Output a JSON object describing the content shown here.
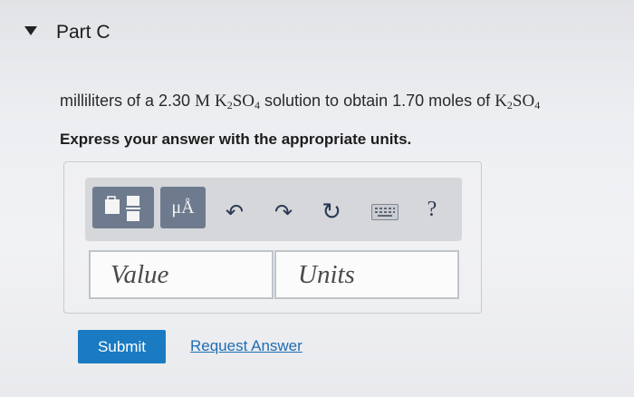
{
  "part": {
    "title": "Part C"
  },
  "question": {
    "lead": "milliliters of a 2.30 ",
    "molarity_unit": "M",
    "solute_1": "K",
    "solute_1_sub": "2",
    "solute_2": "SO",
    "solute_2_sub": "4",
    "middle": " solution to obtain 1.70 moles of ",
    "solute2_1": "K",
    "solute2_1_sub": "2",
    "solute2_2": "SO",
    "solute2_2_sub": "4"
  },
  "instruction": "Express your answer with the appropriate units.",
  "toolbar": {
    "units_label": "μÅ",
    "undo_glyph": "↶",
    "redo_glyph": "↷",
    "reset_glyph": "↻",
    "help_glyph": "?"
  },
  "inputs": {
    "value_placeholder": "Value",
    "units_placeholder": "Units"
  },
  "actions": {
    "submit_label": "Submit",
    "request_label": "Request Answer"
  },
  "colors": {
    "toolbar_button": "#6e7b8e",
    "submit": "#1a7bc2",
    "link": "#1e6eb3"
  }
}
